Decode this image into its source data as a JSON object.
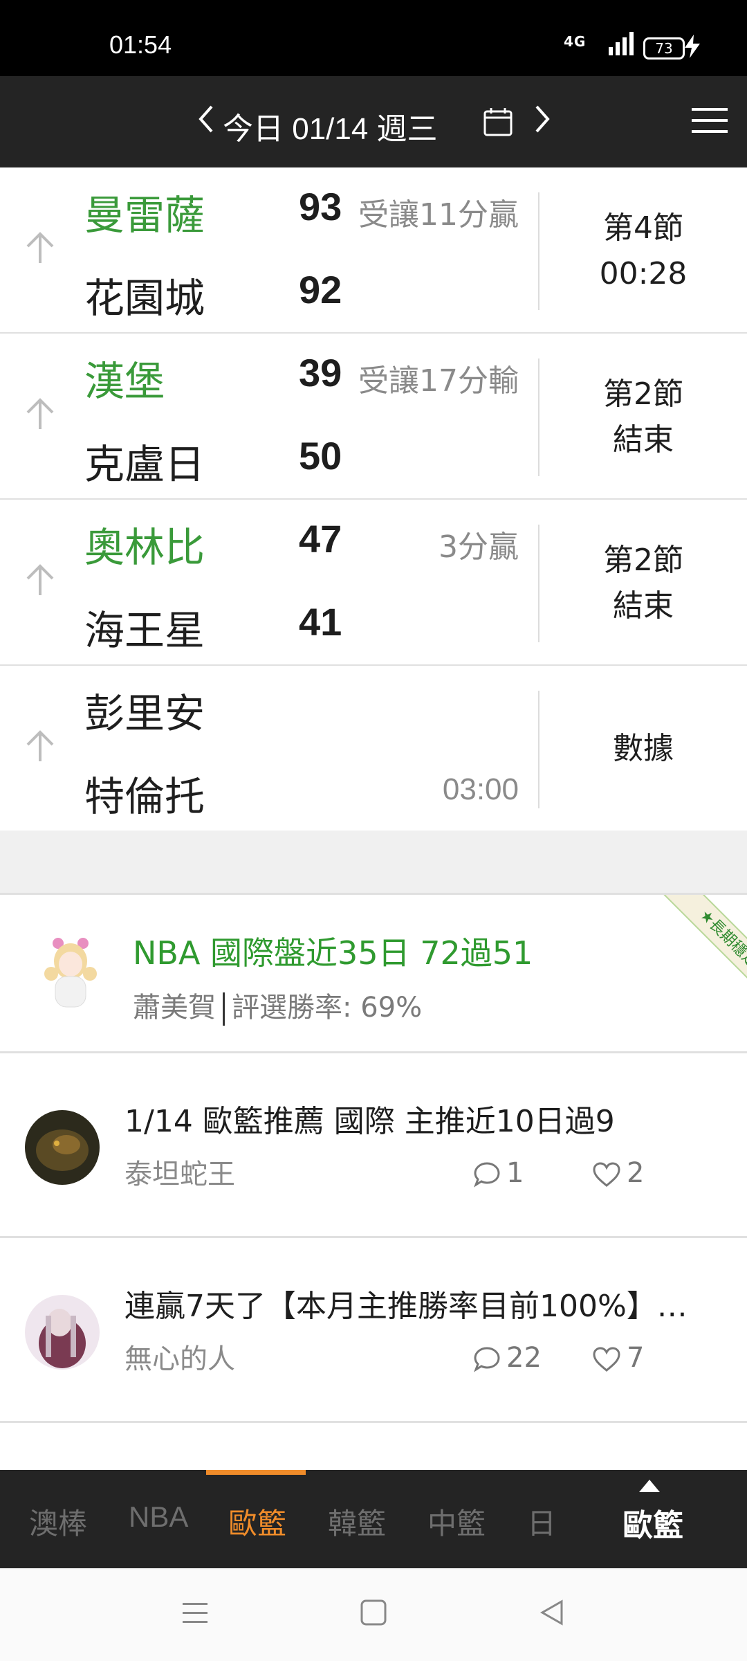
{
  "status_bar": {
    "time": "01:54",
    "network": "4G",
    "battery": "73"
  },
  "header": {
    "date_label": "今日 01/14 週三"
  },
  "games": [
    {
      "team1": "曼雷薩",
      "score1": "93",
      "team2": "花園城",
      "score2": "92",
      "note": "受讓11分贏",
      "status_line1": "第4節",
      "status_line2": "00:28",
      "time": ""
    },
    {
      "team1": "漢堡",
      "score1": "39",
      "team2": "克盧日",
      "score2": "50",
      "note": "受讓17分輸",
      "status_line1": "第2節",
      "status_line2": "結束",
      "time": ""
    },
    {
      "team1": "奧林比",
      "score1": "47",
      "team2": "海王星",
      "score2": "41",
      "note": "3分贏",
      "status_line1": "第2節",
      "status_line2": "結束",
      "time": ""
    },
    {
      "team1": "彭里安",
      "score1": "",
      "team2": "特倫托",
      "score2": "",
      "note": "",
      "status_line1": "數據",
      "status_line2": "",
      "time": "03:00"
    }
  ],
  "featured": {
    "title": "NBA 國際盤近35日 72過51",
    "author": "蕭美賀",
    "win_rate": "評選勝率: 69%",
    "ribbon": "★長期穩定★"
  },
  "posts": [
    {
      "title": "1/14 歐籃推薦 國際 主推近10日過9",
      "author": "泰坦蛇王",
      "comments": "1",
      "likes": "2"
    },
    {
      "title": "連贏7天了【本月主推勝率目前100%】…",
      "author": "無心的人",
      "comments": "22",
      "likes": "7"
    }
  ],
  "tabs": {
    "t0": "澳棒",
    "t1": "NBA",
    "t2": "歐籃",
    "t3": "韓籃",
    "t4": "中籃",
    "t5": "日",
    "current": "歐籃"
  },
  "colors": {
    "accent": "#f08c2a",
    "green": "#3a9a3a",
    "header_bg": "#242424"
  }
}
